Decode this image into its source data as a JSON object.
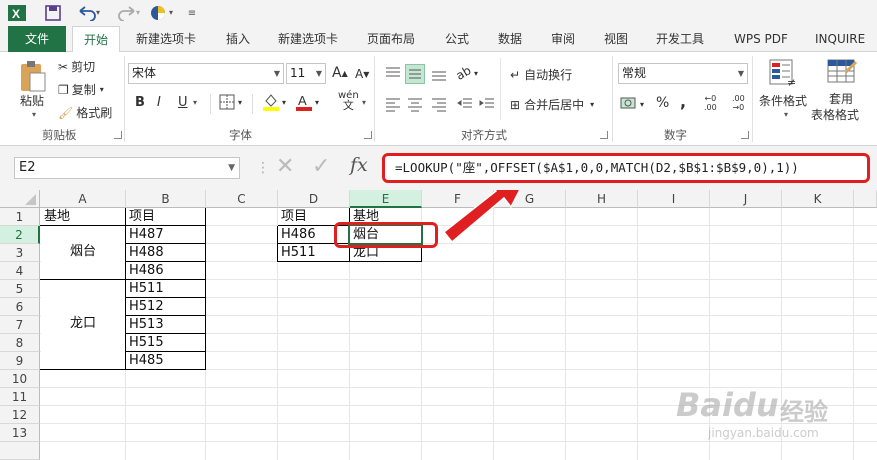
{
  "qat": {
    "app_icon": "excel-logo-icon",
    "icons": [
      "save-icon",
      "undo-icon",
      "redo-icon",
      "color-wheel-icon",
      "customize-icon"
    ]
  },
  "tabs": [
    "文件",
    "开始",
    "新建选项卡",
    "插入",
    "新建选项卡",
    "页面布局",
    "公式",
    "数据",
    "审阅",
    "视图",
    "开发工具",
    "WPS PDF",
    "INQUIRE"
  ],
  "ribbon": {
    "clipboard": {
      "paste": "粘贴",
      "cut": "剪切",
      "copy": "复制",
      "painter": "格式刷",
      "label": "剪贴板"
    },
    "font": {
      "name": "宋体",
      "size": "11",
      "bold": "B",
      "italic": "I",
      "underline": "U",
      "wen": "wén",
      "label": "字体",
      "fill_color": "#FFFF00",
      "font_color": "#E02020"
    },
    "alignment": {
      "wrap": "自动换行",
      "merge": "合并后居中",
      "label": "对齐方式"
    },
    "number": {
      "format": "常规",
      "percent": "%",
      "comma": ",",
      "label": "数字"
    },
    "styles": {
      "cond": "条件格式",
      "table1": "套用",
      "table2": "表格格式"
    }
  },
  "formula_bar": {
    "name_box": "E2",
    "fx": "fx",
    "formula": "=LOOKUP(\"座\",OFFSET($A$1,0,0,MATCH(D2,$B$1:$B$9,0),1))"
  },
  "columns": [
    "A",
    "B",
    "C",
    "D",
    "E",
    "F",
    "G",
    "H",
    "I",
    "J",
    "K"
  ],
  "rows": [
    "1",
    "2",
    "3",
    "4",
    "5",
    "6",
    "7",
    "8",
    "9",
    "10",
    "11",
    "12",
    "13"
  ],
  "cells": {
    "A1": "基地",
    "B1": "项目",
    "A_yantai": "烟台",
    "A_longkou": "龙口",
    "B2": "H487",
    "B3": "H488",
    "B4": "H486",
    "B5": "H511",
    "B6": "H512",
    "B7": "H513",
    "B8": "H515",
    "B9": "H485",
    "D1": "项目",
    "E1": "基地",
    "D2": "H486",
    "E2": "烟台",
    "D3": "H511",
    "E3": "龙口"
  },
  "watermark": {
    "brand": "Baidu",
    "brand_cn": "经验",
    "url": "jingyan.baidu.com"
  },
  "colors": {
    "excel_green": "#217346",
    "highlight_red": "#E02020"
  }
}
